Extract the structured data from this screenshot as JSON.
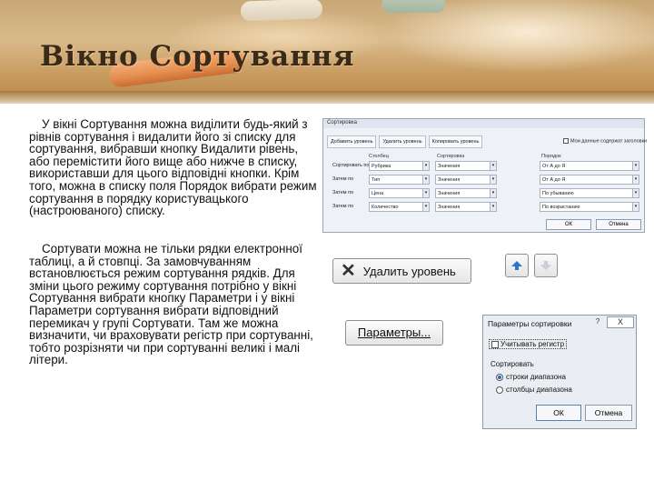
{
  "title": "Вікно Сортування",
  "paragraphs": {
    "p1": "У вікні Сортування можна виділити будь-який з рівнів сортування і видалити його зі списку для сортування, вибравши кнопку Видалити рівень, або перемістити його вище або нижче в списку, використавши для цього відповідні кнопки. Крім того, можна в списку поля Порядок вибрати режим сортування в порядку користувацького (настроюваного) списку.",
    "p2": "Сортувати можна не тільки рядки електронної таблиці, а й стовпці. За замовчуванням встановлюється режим сортування рядків. Для зміни цього режиму сортування потрібно у вікні Сортування вибрати кнопку Параметри і у вікні Параметри сортування вибрати відповідний перемикач у групі Сортувати. Там же можна визначити, чи враховувати регістр при сортуванні, тобто розрізняти чи при сортуванні великі і малі літери."
  },
  "sort_dialog": {
    "title": "Сортировка",
    "toolbar": [
      "Добавить уровень",
      "Удалить уровень",
      "Копировать уровень"
    ],
    "checkbox": "Мои данные содержат заголовки",
    "headers": [
      "Столбец",
      "Сортировка",
      "Порядок"
    ],
    "rows": [
      {
        "label": "Сортировать по",
        "column": "Рубрика",
        "sort": "Значения",
        "order": "От А до Я"
      },
      {
        "label": "Затем по",
        "column": "Тип",
        "sort": "Значения",
        "order": "От А до Я"
      },
      {
        "label": "Затем по",
        "column": "Цена",
        "sort": "Значения",
        "order": "По убыванию"
      },
      {
        "label": "Затем по",
        "column": "Количество",
        "sort": "Значения",
        "order": "По возрастанию"
      }
    ],
    "ok": "ОК",
    "cancel": "Отмена"
  },
  "delete_level_button": "Удалить уровень",
  "parameters_button": "Параметры...",
  "options_dialog": {
    "title": "Параметры сортировки",
    "help": "?",
    "close": "X",
    "case_checkbox": "Учитывать регистр",
    "group_label": "Сортировать",
    "radio_rows": "строки диапазона",
    "radio_columns": "столбцы диапазона",
    "ok": "ОК",
    "cancel": "Отмена"
  }
}
